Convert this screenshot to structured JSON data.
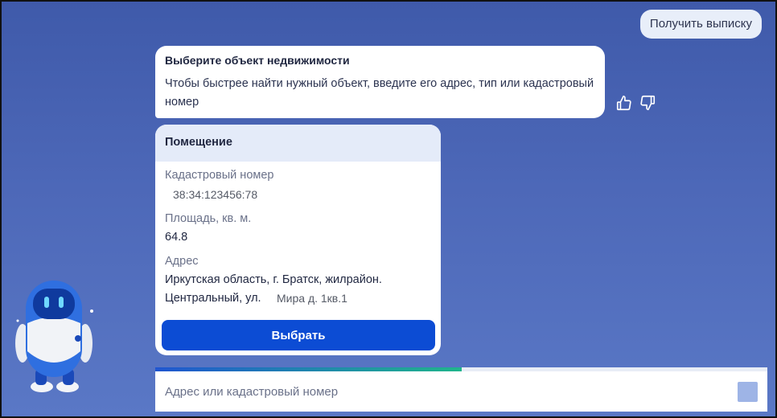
{
  "user_message": "Получить выписку",
  "bot_message": {
    "title": "Выберите объект недвижимости",
    "text": "Чтобы быстрее найти нужный объект, введите его адрес, тип или кадастровый номер"
  },
  "feedback": {
    "like_icon": "thumb-up-icon",
    "dislike_icon": "thumb-down-icon"
  },
  "property_card": {
    "type": "Помещение",
    "cadastral_label": "Кадастровый номер",
    "cadastral_value": "38:34:123456:78",
    "area_label": "Площадь, кв. м.",
    "area_value": "64.8",
    "address_label": "Адрес",
    "address_line1": "Иркутская область, г. Братск, жилрайон.",
    "address_line2_prefix": "Центральный, ул.",
    "address_line2_suffix": "Мира д.  1кв.1",
    "select_button": "Выбрать"
  },
  "progress": {
    "fraction": 0.5
  },
  "input": {
    "placeholder": "Адрес или кадастровый номер",
    "value": ""
  },
  "colors": {
    "accent": "#0c4cd4",
    "background": "#4d68b8"
  }
}
